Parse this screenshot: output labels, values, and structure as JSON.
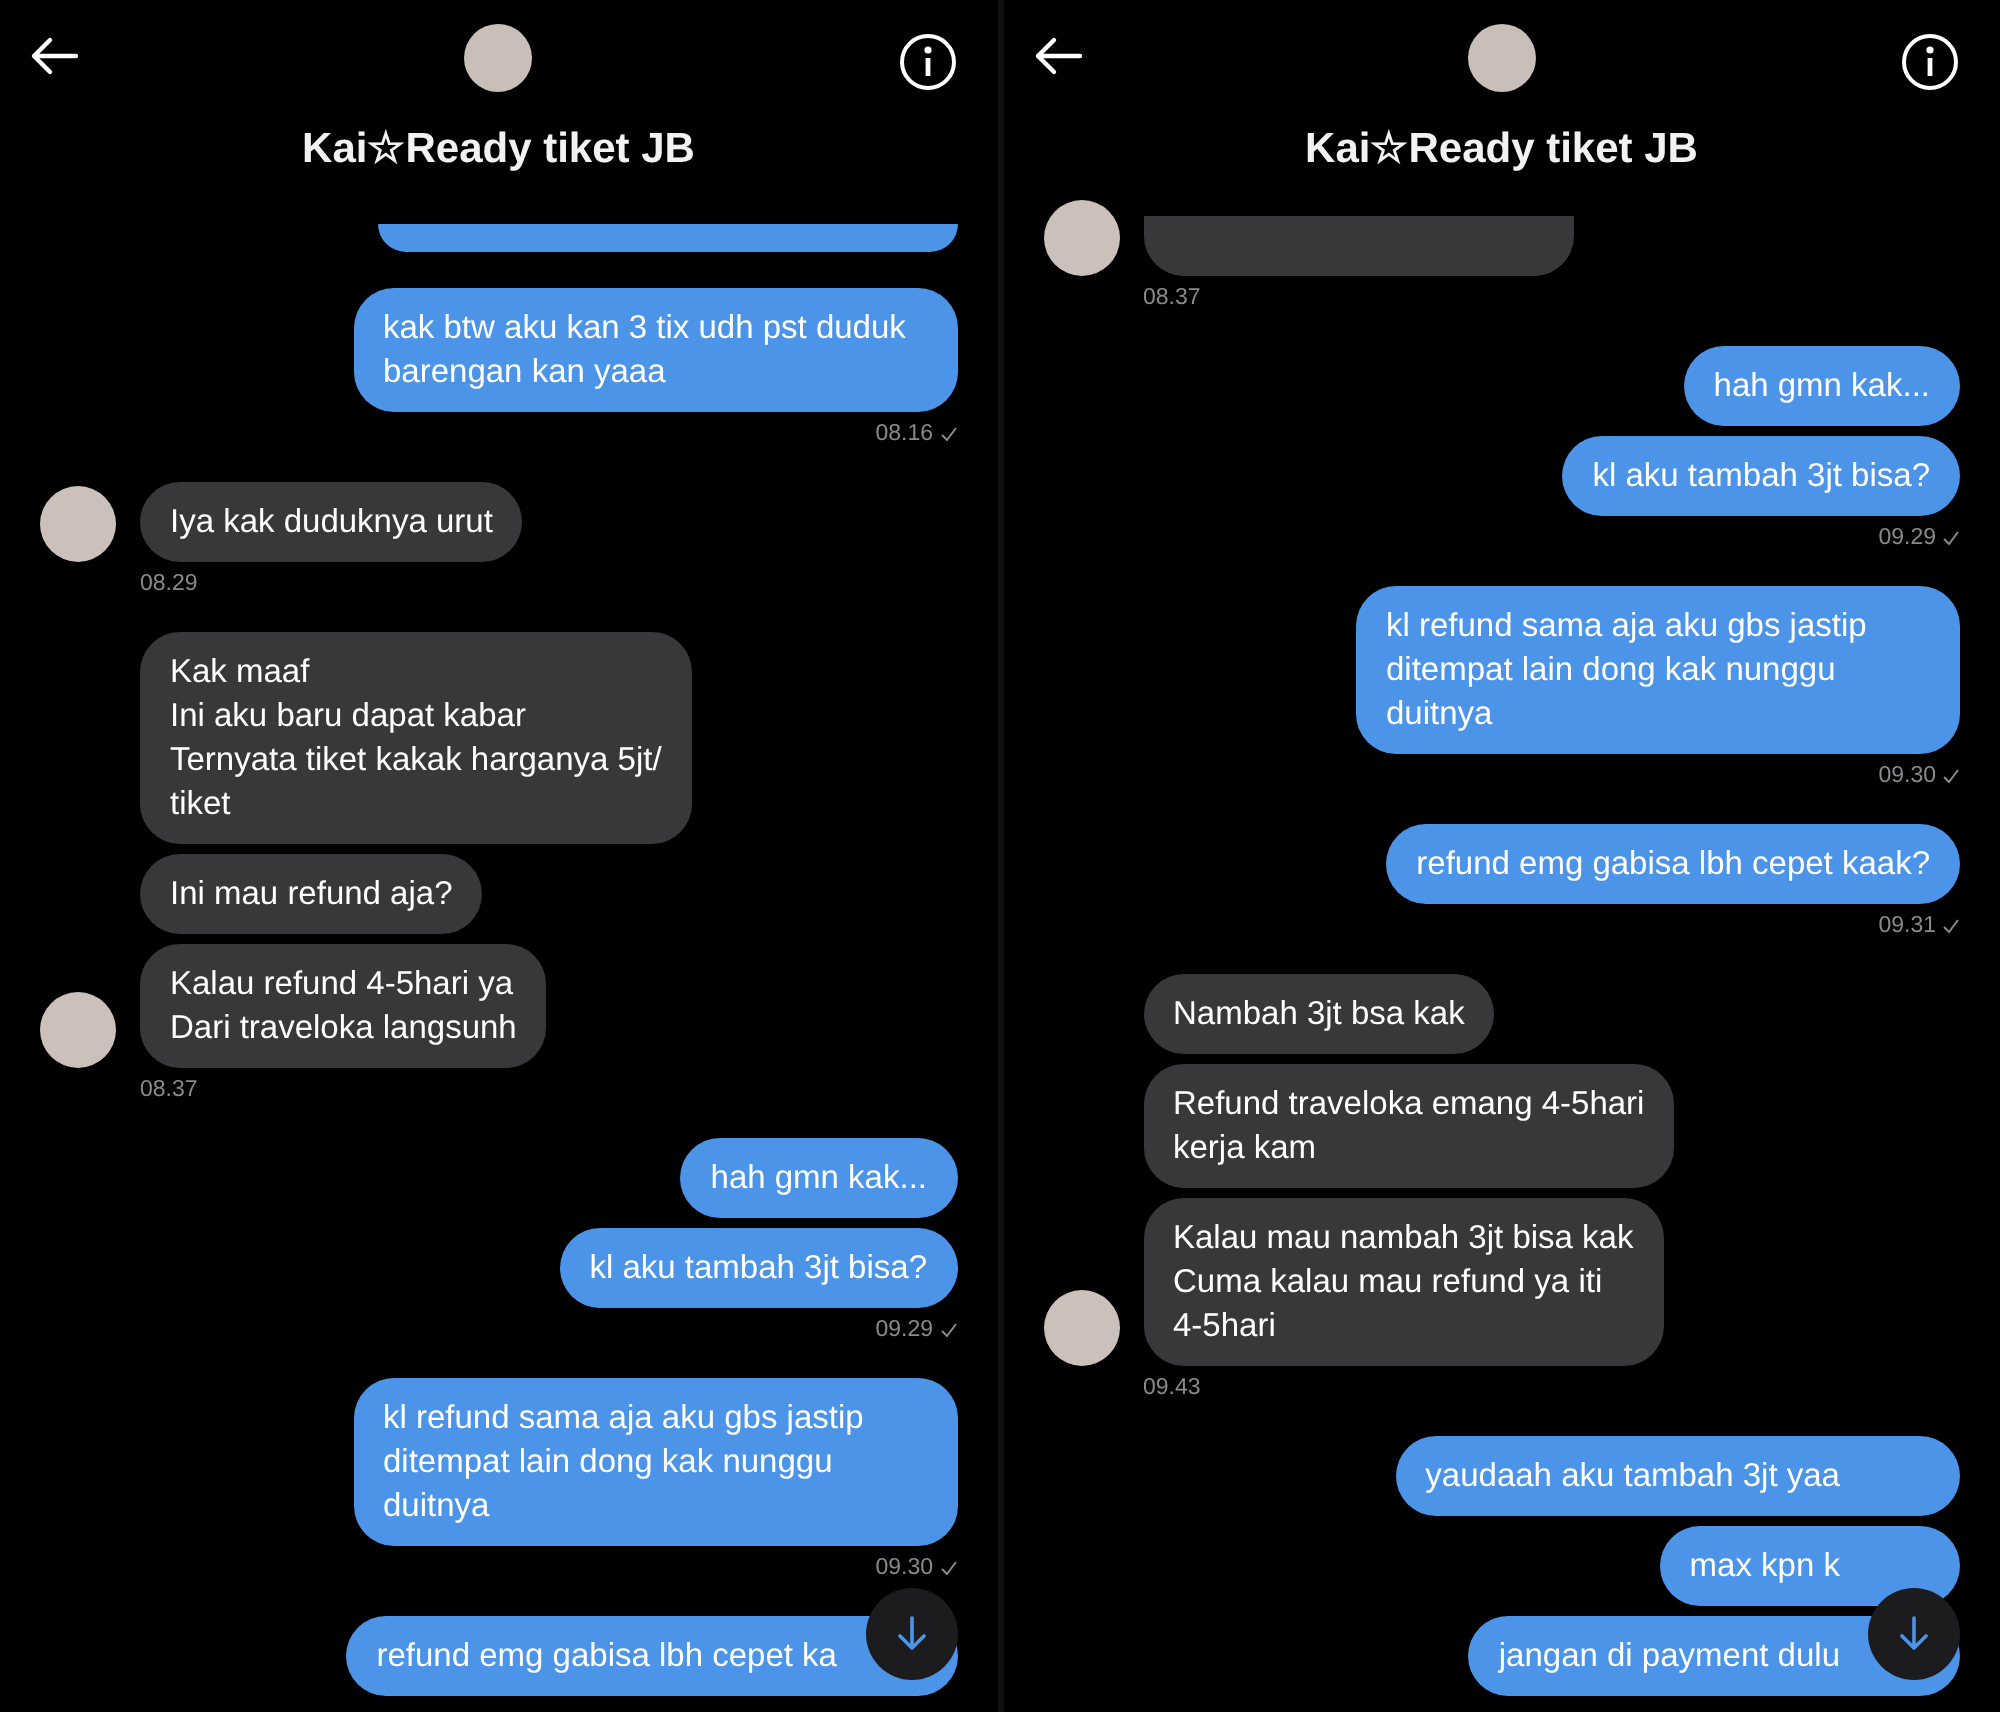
{
  "panels": [
    {
      "header": {
        "title": "Kai☆Ready tiket JB"
      },
      "scroll_button": true,
      "messages": [
        {
          "kind": "fragment",
          "incoming": false
        },
        {
          "kind": "group",
          "incoming": false,
          "bubbles": [
            "kak btw aku kan 3 tix udh pst duduk barengan kan yaaa"
          ],
          "time": "08.16",
          "delivered": true
        },
        {
          "kind": "group",
          "incoming": true,
          "bubbles": [
            "Iya kak duduknya urut"
          ],
          "time": "08.29"
        },
        {
          "kind": "group",
          "incoming": true,
          "bubbles": [
            "Kak maaf\nIni aku baru dapat kabar\nTernyata tiket kakak harganya 5jt/\ntiket",
            "Ini mau refund aja?",
            "Kalau refund 4-5hari ya\nDari traveloka langsunh"
          ],
          "time": "08.37"
        },
        {
          "kind": "group",
          "incoming": false,
          "bubbles": [
            "hah gmn kak...",
            "kl aku tambah 3jt bisa?"
          ],
          "time": "09.29",
          "delivered": true
        },
        {
          "kind": "group",
          "incoming": false,
          "bubbles": [
            "kl refund sama aja aku gbs jastip ditempat lain dong kak nunggu duitnya"
          ],
          "time": "09.30",
          "delivered": true
        },
        {
          "kind": "group",
          "incoming": false,
          "bubbles": [
            "refund emg gabisa lbh cepet ka"
          ]
        }
      ]
    },
    {
      "header": {
        "title": "Kai☆Ready tiket JB"
      },
      "scroll_button": true,
      "messages": [
        {
          "kind": "fragment",
          "incoming": true,
          "time": "08.37"
        },
        {
          "kind": "group",
          "incoming": false,
          "bubbles": [
            "hah gmn kak...",
            "kl aku tambah 3jt bisa?"
          ],
          "time": "09.29",
          "delivered": true
        },
        {
          "kind": "group",
          "incoming": false,
          "bubbles": [
            "kl refund sama aja aku gbs jastip ditempat lain dong kak nunggu duitnya"
          ],
          "time": "09.30",
          "delivered": true
        },
        {
          "kind": "group",
          "incoming": false,
          "bubbles": [
            "refund emg gabisa lbh cepet kaak?"
          ],
          "time": "09.31",
          "delivered": true
        },
        {
          "kind": "group",
          "incoming": true,
          "bubbles": [
            "Nambah 3jt bsa kak",
            "Refund traveloka emang 4-5hari\nkerja kam",
            "Kalau mau nambah 3jt bisa kak\nCuma kalau mau refund ya iti\n4-5hari"
          ],
          "time": "09.43"
        },
        {
          "kind": "group",
          "incoming": false,
          "bubbles": [
            "yaudaah aku tambah 3jt yaa",
            "max kpn k",
            "jangan di payment dulu"
          ]
        }
      ]
    }
  ]
}
